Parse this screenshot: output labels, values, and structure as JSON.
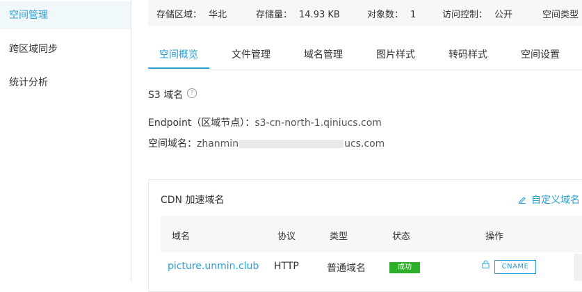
{
  "sidebar": {
    "items": [
      {
        "label": "空间管理",
        "active": true
      },
      {
        "label": "跨区域同步",
        "active": false
      },
      {
        "label": "统计分析",
        "active": false
      }
    ]
  },
  "info": {
    "region_label": "存储区域：",
    "region_value": "华北",
    "storage_label": "存储量：",
    "storage_value": "14.93 KB",
    "objects_label": "对象数：",
    "objects_value": "1",
    "access_label": "访问控制：",
    "access_value": "公开",
    "type_label": "空间类型"
  },
  "tabs": [
    {
      "label": "空间概览",
      "active": true
    },
    {
      "label": "文件管理"
    },
    {
      "label": "域名管理"
    },
    {
      "label": "图片样式"
    },
    {
      "label": "转码样式"
    },
    {
      "label": "空间设置"
    }
  ],
  "s3": {
    "title": "S3 域名",
    "help_glyph": "?",
    "endpoint_label": "Endpoint（区域节点）：",
    "endpoint_value": "s3-cn-north-1.qiniucs.com",
    "domain_label": "空间域名：",
    "domain_prefix": "zhanmin",
    "domain_suffix": "ucs.com"
  },
  "cdn": {
    "title": "CDN 加速域名",
    "custom_domain_label": "自定义域名",
    "columns": [
      "域名",
      "协议",
      "类型",
      "状态",
      "操作"
    ],
    "rows": [
      {
        "domain": "picture.unmin.club",
        "protocol": "HTTP",
        "type": "普通域名",
        "status": "成功",
        "action": "CNAME"
      }
    ]
  },
  "colors": {
    "accent": "#2a9fd6",
    "success": "#2eaf2a"
  }
}
